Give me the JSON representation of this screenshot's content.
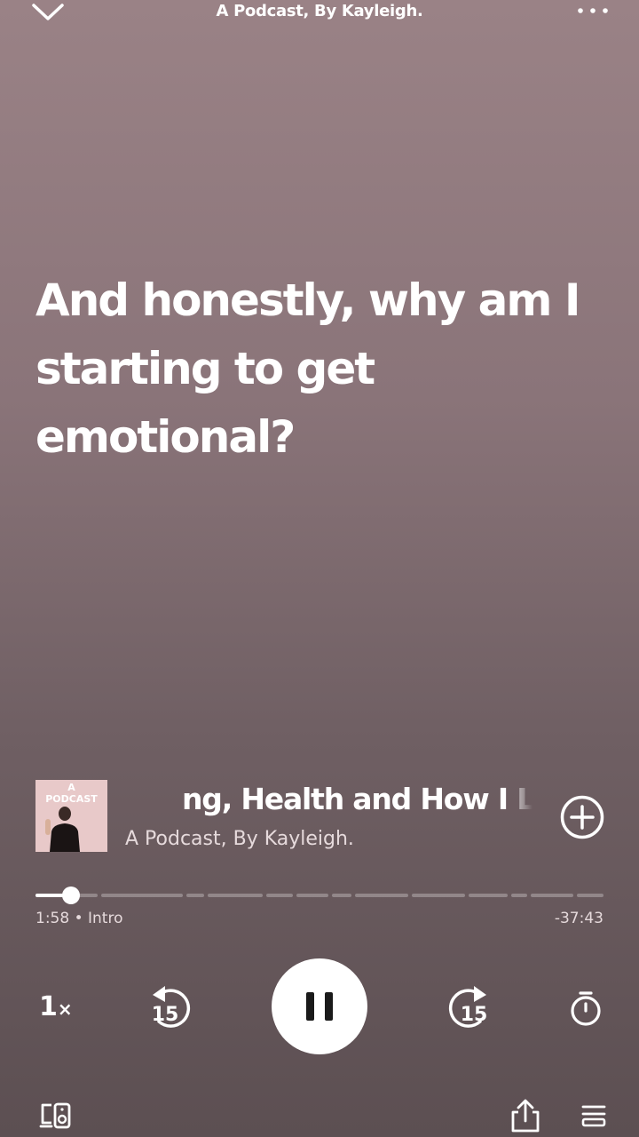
{
  "header": {
    "title": "A Podcast, By Kayleigh."
  },
  "lyrics": {
    "lines": [
      "And honestly, why am I",
      "starting to get",
      "emotional?"
    ]
  },
  "episode": {
    "title": "ng, Health and How I Lost m",
    "show": "A Podcast, By Kayleigh.",
    "cover_label_line1": "A",
    "cover_label_line2": "PODCAST"
  },
  "playback": {
    "elapsed": "1:58",
    "chapter": "Intro",
    "elapsed_display": "1:58 • Intro",
    "remaining": "-37:43",
    "progress_fraction": 0.05,
    "speed_value": "1",
    "speed_suffix": "×",
    "skip_back_seconds": "15",
    "skip_forward_seconds": "15",
    "state": "playing"
  },
  "icons": {
    "collapse": "chevron-down-icon",
    "more": "more-options-icon",
    "add": "add-circle-icon",
    "rewind": "rewind-15-icon",
    "forward": "forward-15-icon",
    "pause": "pause-icon",
    "timer": "sleep-timer-icon",
    "devices": "connect-devices-icon",
    "share": "share-icon",
    "queue": "queue-icon"
  }
}
